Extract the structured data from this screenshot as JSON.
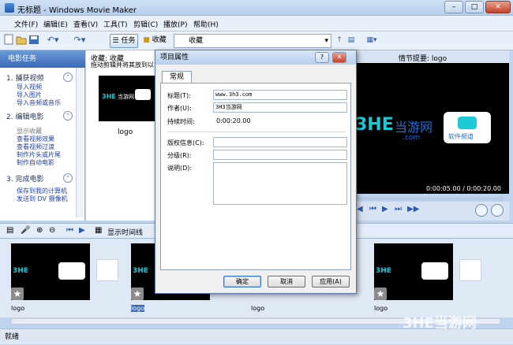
{
  "window": {
    "title": "无标题 - Windows Movie Maker",
    "min": "–",
    "max": "□",
    "close": "✕"
  },
  "menu": [
    "文件(F)",
    "编辑(E)",
    "查看(V)",
    "工具(T)",
    "剪辑(C)",
    "播放(P)",
    "帮助(H)"
  ],
  "toolbar": {
    "tasks_label": "任务",
    "collection_label": "收藏",
    "combo_value": "收藏"
  },
  "tasks": {
    "header": "电影任务",
    "sections": [
      {
        "title": "1. 捕获视频",
        "links": [
          "导入视频",
          "导入图片",
          "导入音频或音乐"
        ]
      },
      {
        "title": "2. 编辑电影",
        "links": [
          "显示收藏",
          "查看视频效果",
          "查看视频过渡",
          "制作片头或片尾",
          "制作自动电影"
        ]
      },
      {
        "title": "3. 完成电影",
        "links": [
          "保存到我的计算机",
          "发送到 DV 摄像机"
        ]
      }
    ]
  },
  "collection": {
    "title": "收藏: 收藏",
    "hint": "拖动剪辑并将其放到以",
    "item_label": "logo"
  },
  "preview": {
    "title": "情节提要: logo",
    "time": "0:00:05.00 / 0:00:20.00"
  },
  "storyboard": {
    "timeline_label": "显示时间线",
    "clips": [
      "logo",
      "logo",
      "logo",
      "logo"
    ]
  },
  "status": "就绪",
  "logo": {
    "text_3he": "3HE",
    "text_cn": "当游网",
    "text_com": ".com",
    "badge": "软件频道",
    "brand": "#1f6fd6",
    "accent": "#19c9d6"
  },
  "watermark": {
    "text": "3HE当游网"
  },
  "dialog": {
    "title": "项目属性",
    "help": "?",
    "close": "✕",
    "tab": "常规",
    "fields": {
      "title_label": "标题(T):",
      "title_value": "www.3h3.com",
      "author_label": "作者(U):",
      "author_value": "3H3当游网",
      "duration_label": "持续时间:",
      "duration_value": "0:00:20.00",
      "copyright_label": "版权信息(C):",
      "rating_label": "分级(R):",
      "desc_label": "说明(D):"
    },
    "buttons": {
      "ok": "确定",
      "cancel": "取消",
      "apply": "应用(A)"
    }
  }
}
